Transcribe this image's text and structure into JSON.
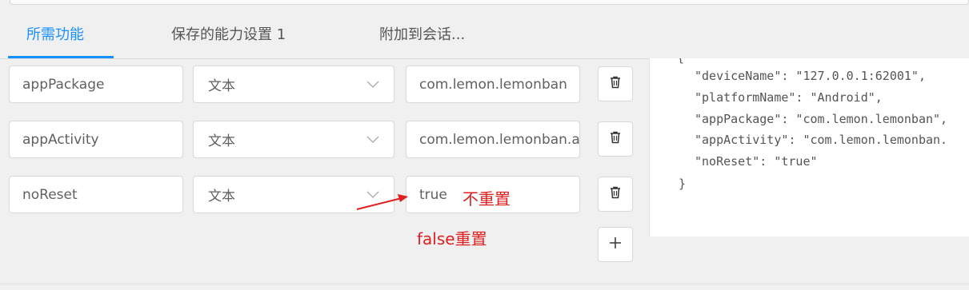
{
  "tabs": [
    {
      "label": "所需功能",
      "active": true
    },
    {
      "label": "保存的能力设置 1",
      "active": false
    },
    {
      "label": "附加到会话...",
      "active": false
    }
  ],
  "capabilities": [
    {
      "name": "appPackage",
      "type": "文本",
      "value": "com.lemon.lemonban"
    },
    {
      "name": "appActivity",
      "type": "文本",
      "value": "com.lemon.lemonban.a"
    },
    {
      "name": "noReset",
      "type": "文本",
      "value": "true"
    }
  ],
  "json_preview": {
    "open_brace": "{",
    "lines": [
      "\"deviceName\": \"127.0.0.1:62001\",",
      "\"platformName\": \"Android\",",
      "\"appPackage\": \"com.lemon.lemonban\",",
      "\"appActivity\": \"com.lemon.lemonban.",
      "\"noReset\": \"true\""
    ],
    "close_brace": "}"
  },
  "annotations": {
    "no_reset": "不重置",
    "false_reset": "false重置",
    "color": "#e02020"
  },
  "icons": {
    "delete": "trash-icon",
    "add": "plus-icon",
    "dropdown": "chevron-down-icon"
  },
  "accent_color": "#1890ff"
}
